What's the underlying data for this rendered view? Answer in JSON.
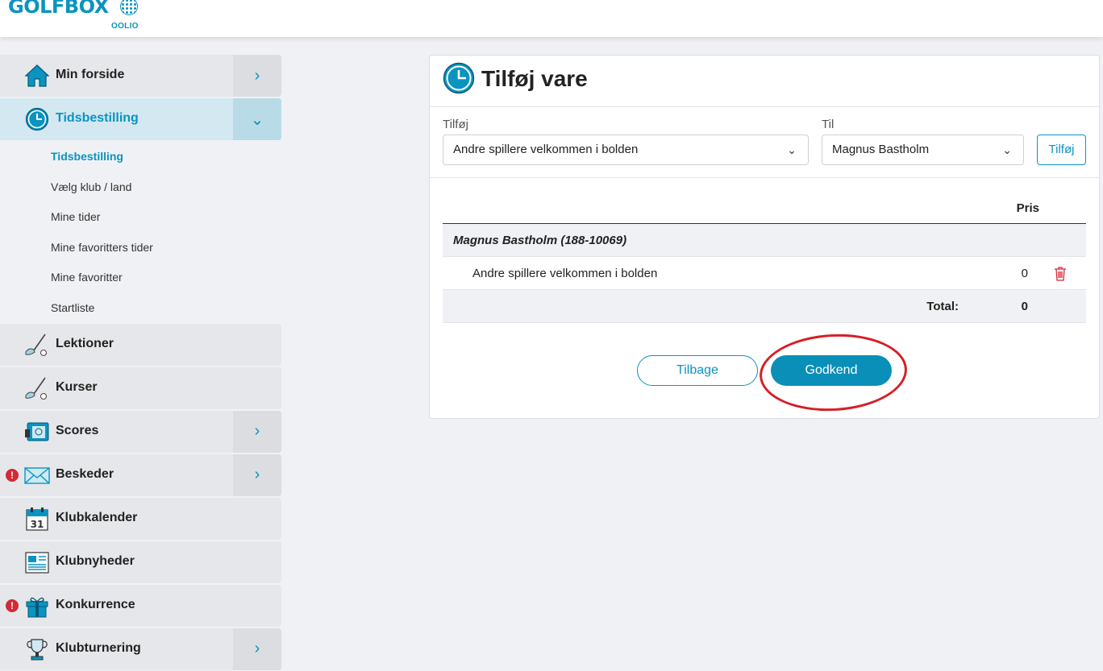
{
  "brand": {
    "name": "GOLFBOX",
    "sub": "OOLIO",
    "color": "#0a94c0"
  },
  "sidebar": {
    "items": [
      {
        "label": "Min forside",
        "icon": "house-icon",
        "chevron": ">"
      },
      {
        "label": "Tidsbestilling",
        "icon": "clock-icon",
        "chevron": "v",
        "active": true
      },
      {
        "label": "Lektioner",
        "icon": "golf-club-icon"
      },
      {
        "label": "Kurser",
        "icon": "golf-club-icon"
      },
      {
        "label": "Scores",
        "icon": "scorecard-icon",
        "chevron": ">"
      },
      {
        "label": "Beskeder",
        "icon": "envelope-icon",
        "chevron": ">",
        "alert": "!"
      },
      {
        "label": "Klubkalender",
        "icon": "calendar-icon",
        "calendar_day": "31"
      },
      {
        "label": "Klubnyheder",
        "icon": "newspaper-icon"
      },
      {
        "label": "Konkurrence",
        "icon": "gift-icon",
        "alert": "!"
      },
      {
        "label": "Klubturnering",
        "icon": "trophy-icon",
        "chevron": ">"
      }
    ],
    "subitems": [
      {
        "label": "Tidsbestilling",
        "current": true
      },
      {
        "label": "Vælg klub / land"
      },
      {
        "label": "Mine tider"
      },
      {
        "label": "Mine favoritters tider"
      },
      {
        "label": "Mine favoritter"
      },
      {
        "label": "Startliste"
      }
    ]
  },
  "panel": {
    "title": "Tilføj vare",
    "add_label": "Tilføj",
    "add_value": "Andre spillere velkommen i bolden",
    "to_label": "Til",
    "to_value": "Magnus Bastholm",
    "add_button": "Tilføj",
    "table": {
      "price_header": "Pris",
      "group": "Magnus Bastholm (188-10069)",
      "item_name": "Andre spillere velkommen i bolden",
      "item_price": "0",
      "total_label": "Total:",
      "total_value": "0"
    },
    "back_button": "Tilbage",
    "approve_button": "Godkend"
  },
  "colors": {
    "accent": "#0a94c0",
    "alert": "#d32a36",
    "annotation": "#d61f26"
  }
}
